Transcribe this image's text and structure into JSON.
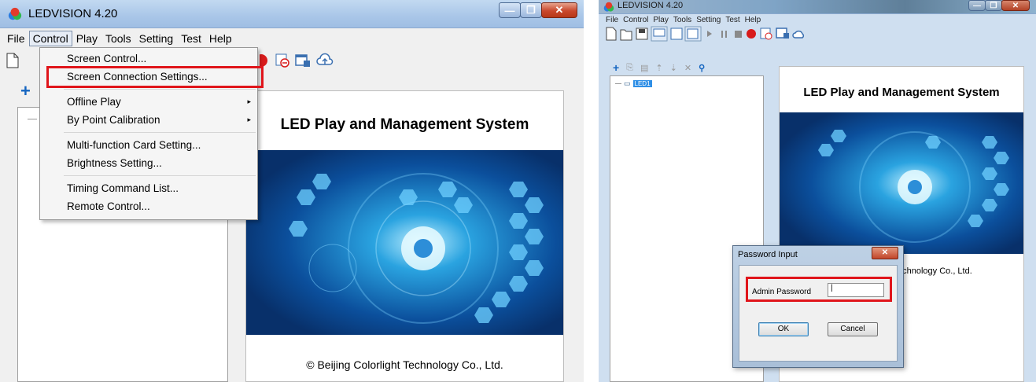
{
  "left_window": {
    "title": "LEDVISION 4.20",
    "caption_buttons": {
      "minimize": "—",
      "maximize": "❐",
      "close": "✕"
    },
    "menu": [
      "File",
      "Control",
      "Play",
      "Tools",
      "Setting",
      "Test",
      "Help"
    ],
    "open_menu": "Control",
    "dropdown": {
      "items": [
        {
          "label": "Screen Control..."
        },
        {
          "label": "Screen Connection Settings...",
          "highlighted": true
        },
        {
          "label": "Offline Play",
          "submenu": true
        },
        {
          "label": "By Point Calibration",
          "submenu": true
        },
        {
          "label": "Multi-function Card Setting..."
        },
        {
          "label": "Brightness Setting..."
        },
        {
          "label": "Timing Command List..."
        },
        {
          "label": "Remote Control..."
        }
      ],
      "arrow": "▸"
    },
    "plus": "+",
    "banner": {
      "title": "LED Play and Management System",
      "copyright": "© Beijing Colorlight Technology Co., Ltd."
    }
  },
  "right_window": {
    "title": "LEDVISION 4.20",
    "caption_buttons": {
      "minimize": "—",
      "maximize": "❐",
      "close": "✕"
    },
    "menu": [
      "File",
      "Control",
      "Play",
      "Tools",
      "Setting",
      "Test",
      "Help"
    ],
    "tree_item": "LED1",
    "banner": {
      "title": "LED Play and Management System",
      "copyright_partial": "echnology Co., Ltd."
    },
    "dialog": {
      "title": "Password Input",
      "close": "✕",
      "label": "Admin Password",
      "value": "|",
      "ok": "OK",
      "cancel": "Cancel"
    }
  },
  "colors": {
    "highlight_box": "#e0151b",
    "accent": "#1565c0"
  }
}
